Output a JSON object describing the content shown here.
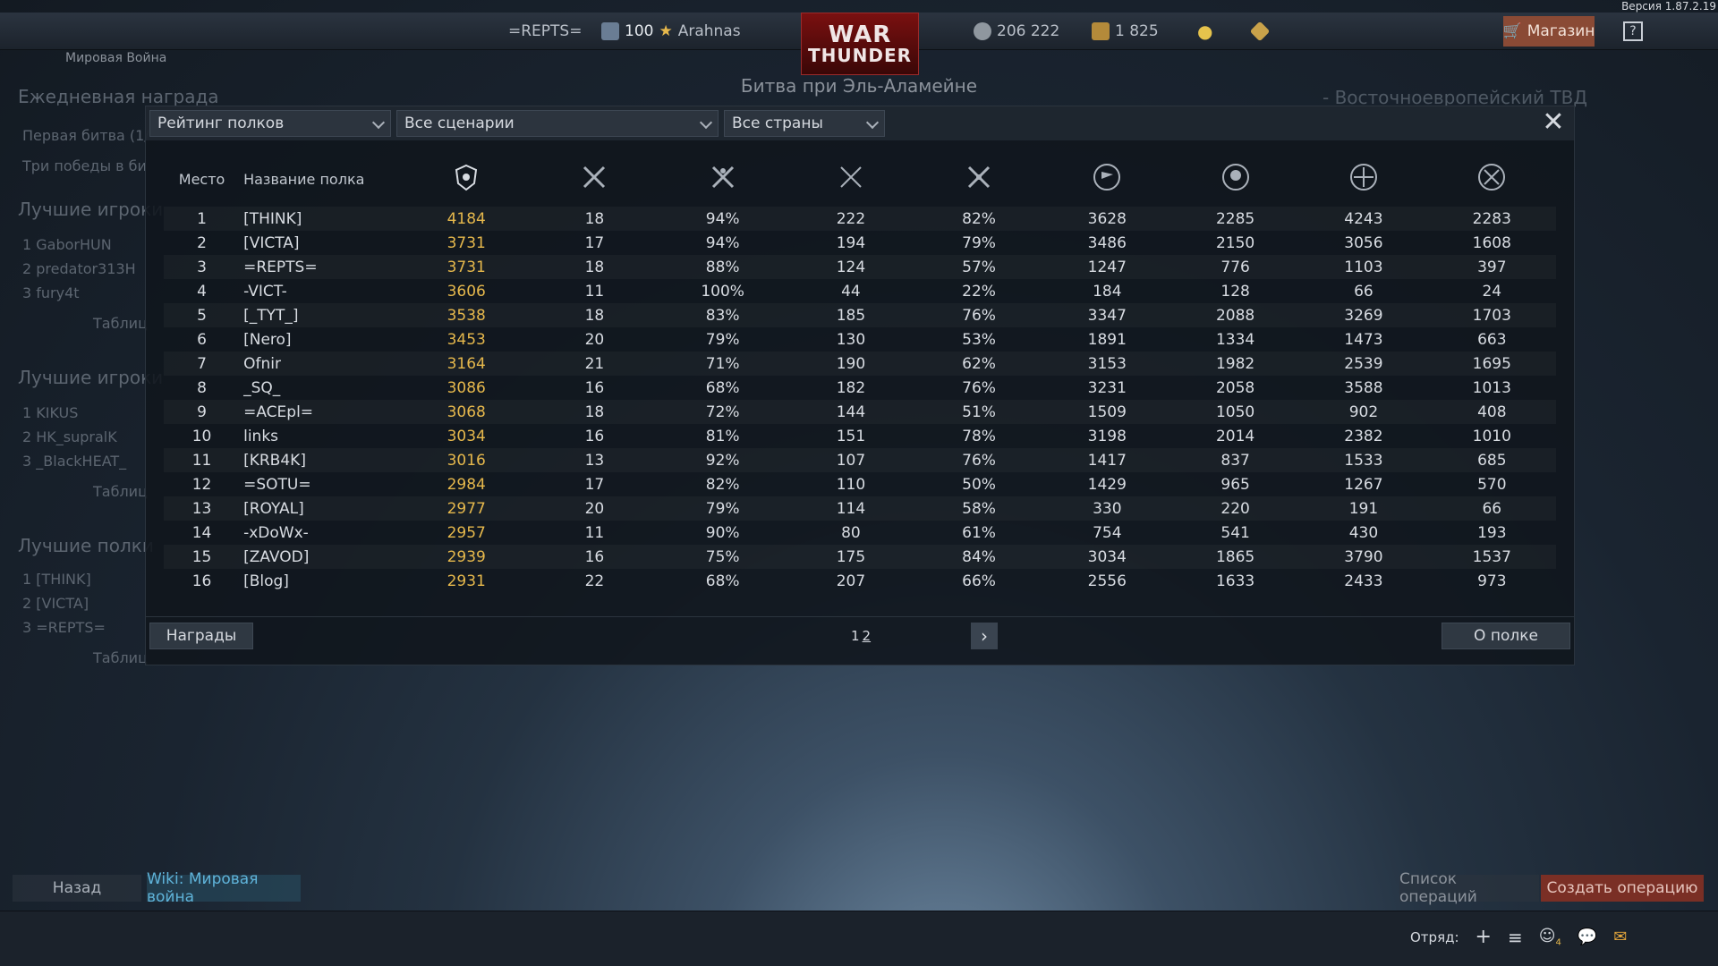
{
  "version": "Версия 1.87.2.19",
  "topbar": {
    "squadron_tag": "=REPTS=",
    "player_level": "100",
    "player_name": "Arahnas",
    "logo_line1": "WAR",
    "logo_line2": "THUNDER",
    "silver_lions": "206 222",
    "golden_eagles": "1 825",
    "shop_label": "Магазин",
    "help_label": "?"
  },
  "header": {
    "section_label": "Мировая Война",
    "battle_title": "Битва при Эль-Аламейне",
    "theatre": "- Восточноевропейский ТВД"
  },
  "background_panel": {
    "daily_reward": "Ежедневная награда",
    "first_battle": "Первая битва (1/",
    "three_wins": "Три победы в би",
    "best_players_1": "Лучшие игроки",
    "best_players_1_list": [
      "1  GaborHUN",
      "2  predator313H",
      "3  fury4t"
    ],
    "table_btn": "Таблиц",
    "best_players_2": "Лучшие игроки",
    "best_players_2_list": [
      "1  KIKUS",
      "2  HK_supralK",
      "3  _BlackHEAT_"
    ],
    "best_regiments": "Лучшие полки",
    "best_regiments_list": [
      "1  [THINK]",
      "2  [VICTA]",
      "3  =REPTS="
    ]
  },
  "filters": {
    "rating_type": "Рейтинг полков",
    "scenario": "Все сценарии",
    "country": "Все страны"
  },
  "table": {
    "col_place": "Место",
    "col_name": "Название полка",
    "rows": [
      {
        "place": "1",
        "name": "[THINK]",
        "rating": "4184",
        "c1": "18",
        "c2": "94%",
        "c3": "222",
        "c4": "82%",
        "c5": "3628",
        "c6": "2285",
        "c7": "4243",
        "c8": "2283"
      },
      {
        "place": "2",
        "name": "[VICTA]",
        "rating": "3731",
        "c1": "17",
        "c2": "94%",
        "c3": "194",
        "c4": "79%",
        "c5": "3486",
        "c6": "2150",
        "c7": "3056",
        "c8": "1608"
      },
      {
        "place": "3",
        "name": "=REPTS=",
        "rating": "3731",
        "c1": "18",
        "c2": "88%",
        "c3": "124",
        "c4": "57%",
        "c5": "1247",
        "c6": "776",
        "c7": "1103",
        "c8": "397"
      },
      {
        "place": "4",
        "name": "-VICT-",
        "rating": "3606",
        "c1": "11",
        "c2": "100%",
        "c3": "44",
        "c4": "22%",
        "c5": "184",
        "c6": "128",
        "c7": "66",
        "c8": "24"
      },
      {
        "place": "5",
        "name": "[_TYT_]",
        "rating": "3538",
        "c1": "18",
        "c2": "83%",
        "c3": "185",
        "c4": "76%",
        "c5": "3347",
        "c6": "2088",
        "c7": "3269",
        "c8": "1703"
      },
      {
        "place": "6",
        "name": "[Nero]",
        "rating": "3453",
        "c1": "20",
        "c2": "79%",
        "c3": "130",
        "c4": "53%",
        "c5": "1891",
        "c6": "1334",
        "c7": "1473",
        "c8": "663"
      },
      {
        "place": "7",
        "name": "Ofnir",
        "rating": "3164",
        "c1": "21",
        "c2": "71%",
        "c3": "190",
        "c4": "62%",
        "c5": "3153",
        "c6": "1982",
        "c7": "2539",
        "c8": "1695"
      },
      {
        "place": "8",
        "name": "_SQ_",
        "rating": "3086",
        "c1": "16",
        "c2": "68%",
        "c3": "182",
        "c4": "76%",
        "c5": "3231",
        "c6": "2058",
        "c7": "3588",
        "c8": "1013"
      },
      {
        "place": "9",
        "name": "=ACEpl=",
        "rating": "3068",
        "c1": "18",
        "c2": "72%",
        "c3": "144",
        "c4": "51%",
        "c5": "1509",
        "c6": "1050",
        "c7": "902",
        "c8": "408"
      },
      {
        "place": "10",
        "name": "links",
        "rating": "3034",
        "c1": "16",
        "c2": "81%",
        "c3": "151",
        "c4": "78%",
        "c5": "3198",
        "c6": "2014",
        "c7": "2382",
        "c8": "1010"
      },
      {
        "place": "11",
        "name": "[KRB4K]",
        "rating": "3016",
        "c1": "13",
        "c2": "92%",
        "c3": "107",
        "c4": "76%",
        "c5": "1417",
        "c6": "837",
        "c7": "1533",
        "c8": "685"
      },
      {
        "place": "12",
        "name": "=SOTU=",
        "rating": "2984",
        "c1": "17",
        "c2": "82%",
        "c3": "110",
        "c4": "50%",
        "c5": "1429",
        "c6": "965",
        "c7": "1267",
        "c8": "570"
      },
      {
        "place": "13",
        "name": "[ROYAL]",
        "rating": "2977",
        "c1": "20",
        "c2": "79%",
        "c3": "114",
        "c4": "58%",
        "c5": "330",
        "c6": "220",
        "c7": "191",
        "c8": "66"
      },
      {
        "place": "14",
        "name": "-xDoWx-",
        "rating": "2957",
        "c1": "11",
        "c2": "90%",
        "c3": "80",
        "c4": "61%",
        "c5": "754",
        "c6": "541",
        "c7": "430",
        "c8": "193"
      },
      {
        "place": "15",
        "name": "[ZAVOD]",
        "rating": "2939",
        "c1": "16",
        "c2": "75%",
        "c3": "175",
        "c4": "84%",
        "c5": "3034",
        "c6": "1865",
        "c7": "3790",
        "c8": "1537"
      },
      {
        "place": "16",
        "name": "[Blog]",
        "rating": "2931",
        "c1": "22",
        "c2": "68%",
        "c3": "207",
        "c4": "66%",
        "c5": "2556",
        "c6": "1633",
        "c7": "2433",
        "c8": "973"
      }
    ]
  },
  "footer": {
    "rewards_btn": "Награды",
    "page1": "1",
    "page2": "2",
    "regiment_btn": "О полке"
  },
  "bottom": {
    "back_btn": "Назад",
    "wiki_link": "Wiki: Мировая война",
    "operations_list": "Список операций",
    "create_operation": "Создать операцию",
    "squad_label": "Отряд:",
    "friends_count": "4"
  },
  "colors": {
    "rating": "#e6b84c",
    "shop": "#8a4a35",
    "create_operation": "#7a2f25",
    "logo": "#7a1010"
  }
}
